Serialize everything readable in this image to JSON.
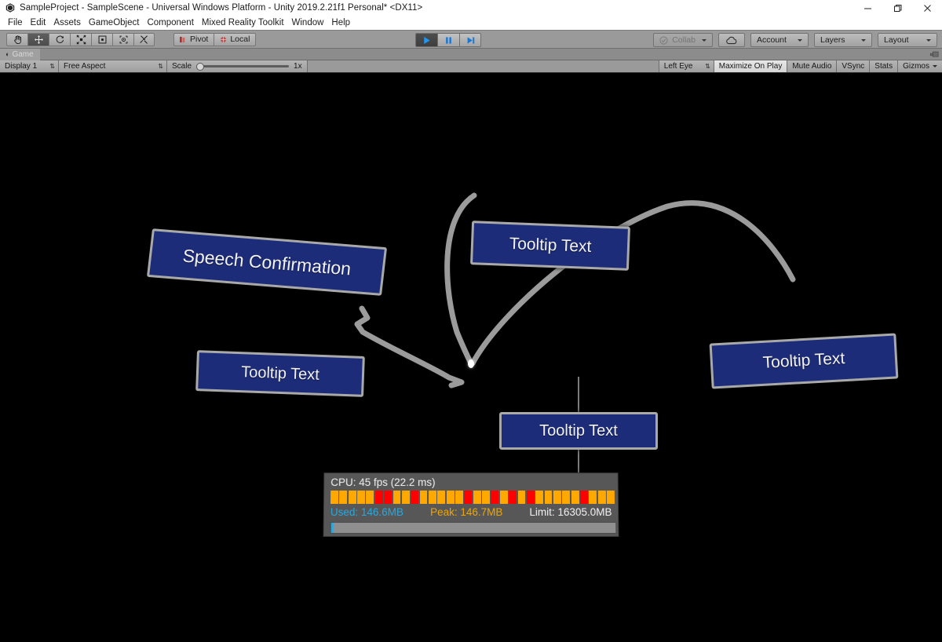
{
  "window": {
    "title": "SampleProject - SampleScene - Universal Windows Platform - Unity 2019.2.21f1 Personal* <DX11>",
    "minimize_label": "─",
    "restore_label": "❐",
    "close_label": "✕"
  },
  "menubar": {
    "items": [
      {
        "label": "File"
      },
      {
        "label": "Edit"
      },
      {
        "label": "Assets"
      },
      {
        "label": "GameObject"
      },
      {
        "label": "Component"
      },
      {
        "label": "Mixed Reality Toolkit"
      },
      {
        "label": "Window"
      },
      {
        "label": "Help"
      }
    ]
  },
  "toolbar": {
    "tools": [
      {
        "name": "hand-tool",
        "active": false
      },
      {
        "name": "move-tool",
        "active": true
      },
      {
        "name": "rotate-tool",
        "active": false
      },
      {
        "name": "scale-tool",
        "active": false
      },
      {
        "name": "rect-tool",
        "active": false
      },
      {
        "name": "transform-tool",
        "active": false
      },
      {
        "name": "custom-tool",
        "active": false
      }
    ],
    "pivot_label": "Pivot",
    "local_label": "Local",
    "play_label": "Play",
    "pause_label": "Pause",
    "step_label": "Step",
    "collab_label": "Collab",
    "cloud_label": "Cloud",
    "account_label": "Account",
    "layers_label": "Layers",
    "layout_label": "Layout"
  },
  "gameview": {
    "tab_label": "Game",
    "display_label": "Display 1",
    "aspect_label": "Free Aspect",
    "scale_label": "Scale",
    "scale_value": "1x",
    "eye_label": "Left Eye",
    "maximize_label": "Maximize On Play",
    "mute_label": "Mute Audio",
    "vsync_label": "VSync",
    "stats_label": "Stats",
    "gizmos_label": "Gizmos"
  },
  "scene": {
    "tooltips": [
      {
        "id": "speech",
        "text": "Speech Confirmation"
      },
      {
        "id": "top",
        "text": "Tooltip Text"
      },
      {
        "id": "left",
        "text": "Tooltip Text"
      },
      {
        "id": "right",
        "text": "Tooltip Text"
      },
      {
        "id": "center",
        "text": "Tooltip Text"
      }
    ],
    "panel_color": "#1d2c78",
    "panel_border_color": "#a9a9a9",
    "connector_color": "#9b9b9b"
  },
  "profiler": {
    "cpu_label": "CPU: 45 fps (22.2 ms)",
    "fps": 45,
    "frame_ms": 22.2,
    "used_label": "Used: 146.6MB",
    "peak_label": "Peak: 146.7MB",
    "limit_label": "Limit: 16305.0MB",
    "used_mb": 146.6,
    "peak_mb": 146.7,
    "limit_mb": 16305.0,
    "memory_fill_percent": 0.9,
    "colors": {
      "good": "#ffa800",
      "bad": "#ff0000",
      "used": "#29a8e0",
      "peak": "#f0a500",
      "limit": "#f2f2f2",
      "bar_bg": "#8f8f8f",
      "panel_bg": "#575757"
    },
    "frame_bars": [
      "good",
      "good",
      "good",
      "good",
      "good",
      "bad",
      "bad",
      "good",
      "good",
      "bad",
      "good",
      "good",
      "good",
      "good",
      "good",
      "bad",
      "good",
      "good",
      "bad",
      "good",
      "bad",
      "good",
      "bad",
      "good",
      "good",
      "good",
      "good",
      "good",
      "bad",
      "good",
      "good",
      "good"
    ]
  }
}
